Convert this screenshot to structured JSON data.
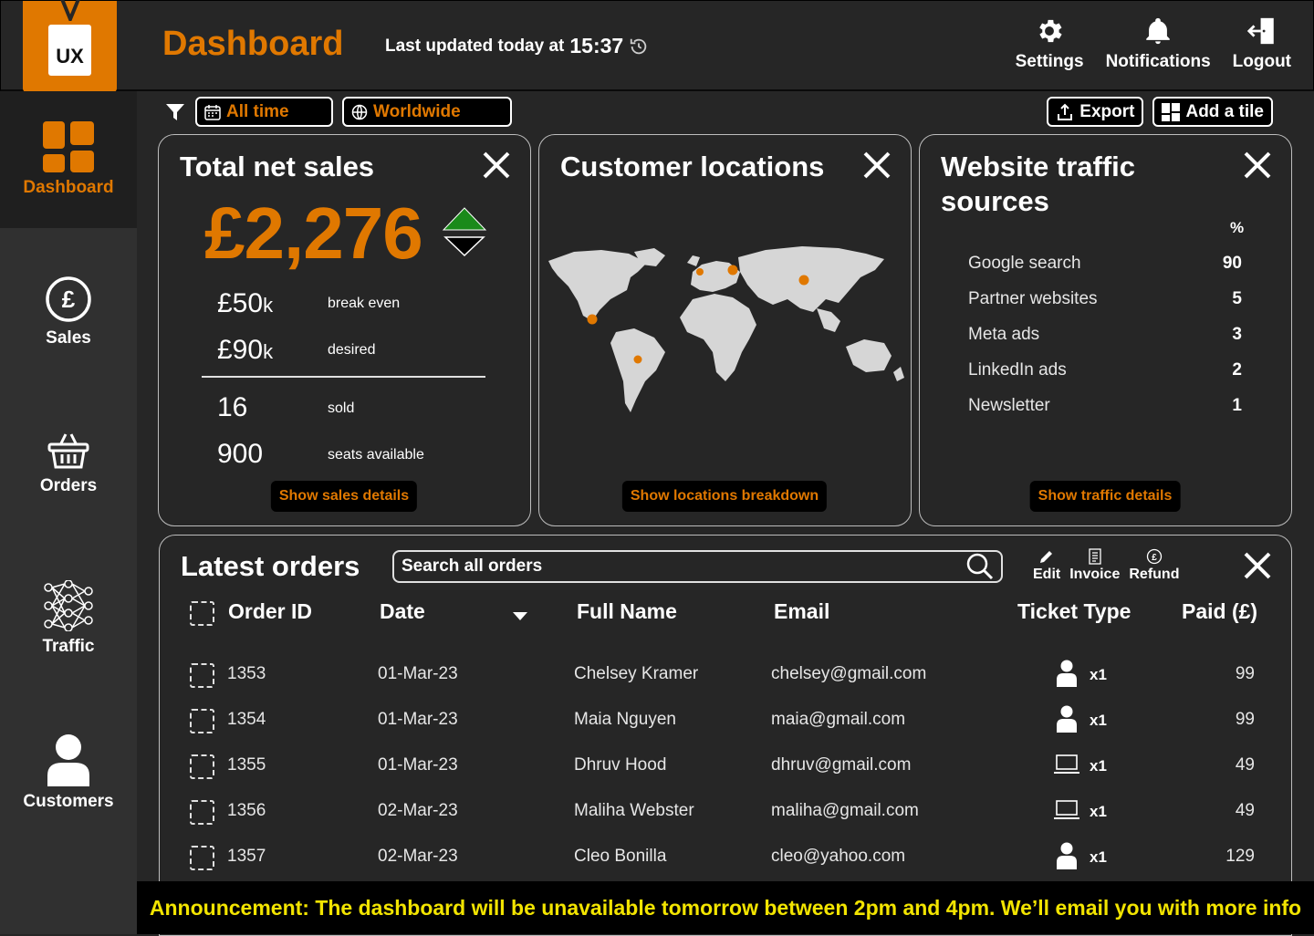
{
  "header": {
    "logo_text": "UX",
    "title": "Dashboard",
    "last_updated_label": "Last updated today at",
    "last_updated_time": "15:37",
    "nav": [
      {
        "label": "Settings",
        "icon": "gear-icon"
      },
      {
        "label": "Notifications",
        "icon": "bell-icon"
      },
      {
        "label": "Logout",
        "icon": "logout-icon"
      }
    ]
  },
  "sidebar": {
    "items": [
      {
        "label": "Dashboard",
        "icon": "dashboard-grid-icon",
        "active": true
      },
      {
        "label": "Sales",
        "icon": "pound-circle-icon"
      },
      {
        "label": "Orders",
        "icon": "basket-icon"
      },
      {
        "label": "Traffic",
        "icon": "network-icon"
      },
      {
        "label": "Customers",
        "icon": "user-icon"
      }
    ]
  },
  "filters": {
    "time": "All time",
    "region": "Worldwide"
  },
  "actions": {
    "export": "Export",
    "add_tile": "Add a tile"
  },
  "sales_card": {
    "title": "Total net sales",
    "value": "£2,276",
    "break_even_value": "£50",
    "break_even_unit": "k",
    "break_even_label": "break even",
    "desired_value": "£90",
    "desired_unit": "k",
    "desired_label": "desired",
    "sold_value": "16",
    "sold_label": "sold",
    "seats_value": "900",
    "seats_label": "seats available",
    "cta": "Show sales details"
  },
  "locations_card": {
    "title": "Customer locations",
    "cta": "Show locations breakdown"
  },
  "traffic_card": {
    "title": "Website traffic sources",
    "unit_header": "%",
    "rows": [
      {
        "source": "Google search",
        "percent": "90"
      },
      {
        "source": "Partner websites",
        "percent": "5"
      },
      {
        "source": "Meta ads",
        "percent": "3"
      },
      {
        "source": "LinkedIn ads",
        "percent": "2"
      },
      {
        "source": "Newsletter",
        "percent": "1"
      }
    ],
    "cta": "Show traffic details"
  },
  "orders": {
    "title": "Latest orders",
    "search_placeholder": "Search all orders",
    "tools": [
      {
        "label": "Edit",
        "icon": "pencil-icon"
      },
      {
        "label": "Invoice",
        "icon": "invoice-icon"
      },
      {
        "label": "Refund",
        "icon": "refund-icon"
      }
    ],
    "columns": [
      "Order ID",
      "Date",
      "Full Name",
      "Email",
      "Ticket Type",
      "Paid (£)"
    ],
    "rows": [
      {
        "id": "1353",
        "date": "01-Mar-23",
        "name": "Chelsey Kramer",
        "email": "chelsey@gmail.com",
        "ticket_icon": "person-icon",
        "qty": "x1",
        "paid": "99"
      },
      {
        "id": "1354",
        "date": "01-Mar-23",
        "name": "Maia Nguyen",
        "email": "maia@gmail.com",
        "ticket_icon": "person-icon",
        "qty": "x1",
        "paid": "99"
      },
      {
        "id": "1355",
        "date": "01-Mar-23",
        "name": "Dhruv Hood",
        "email": "dhruv@gmail.com",
        "ticket_icon": "laptop-icon",
        "qty": "x1",
        "paid": "49"
      },
      {
        "id": "1356",
        "date": "02-Mar-23",
        "name": "Maliha Webster",
        "email": "maliha@gmail.com",
        "ticket_icon": "laptop-icon",
        "qty": "x1",
        "paid": "49"
      },
      {
        "id": "1357",
        "date": "02-Mar-23",
        "name": "Cleo Bonilla",
        "email": "cleo@yahoo.com",
        "ticket_icon": "person-icon",
        "qty": "x1",
        "paid": "129"
      }
    ]
  },
  "announcement": "Announcement: The dashboard will be unavailable tomorrow between 2pm and 4pm. We’ll email you with more info",
  "colors": {
    "accent": "#e07800",
    "background": "#262626",
    "sidebar": "#303030",
    "announcement_text": "#f2e400",
    "trend_up": "#1a8a1a"
  }
}
